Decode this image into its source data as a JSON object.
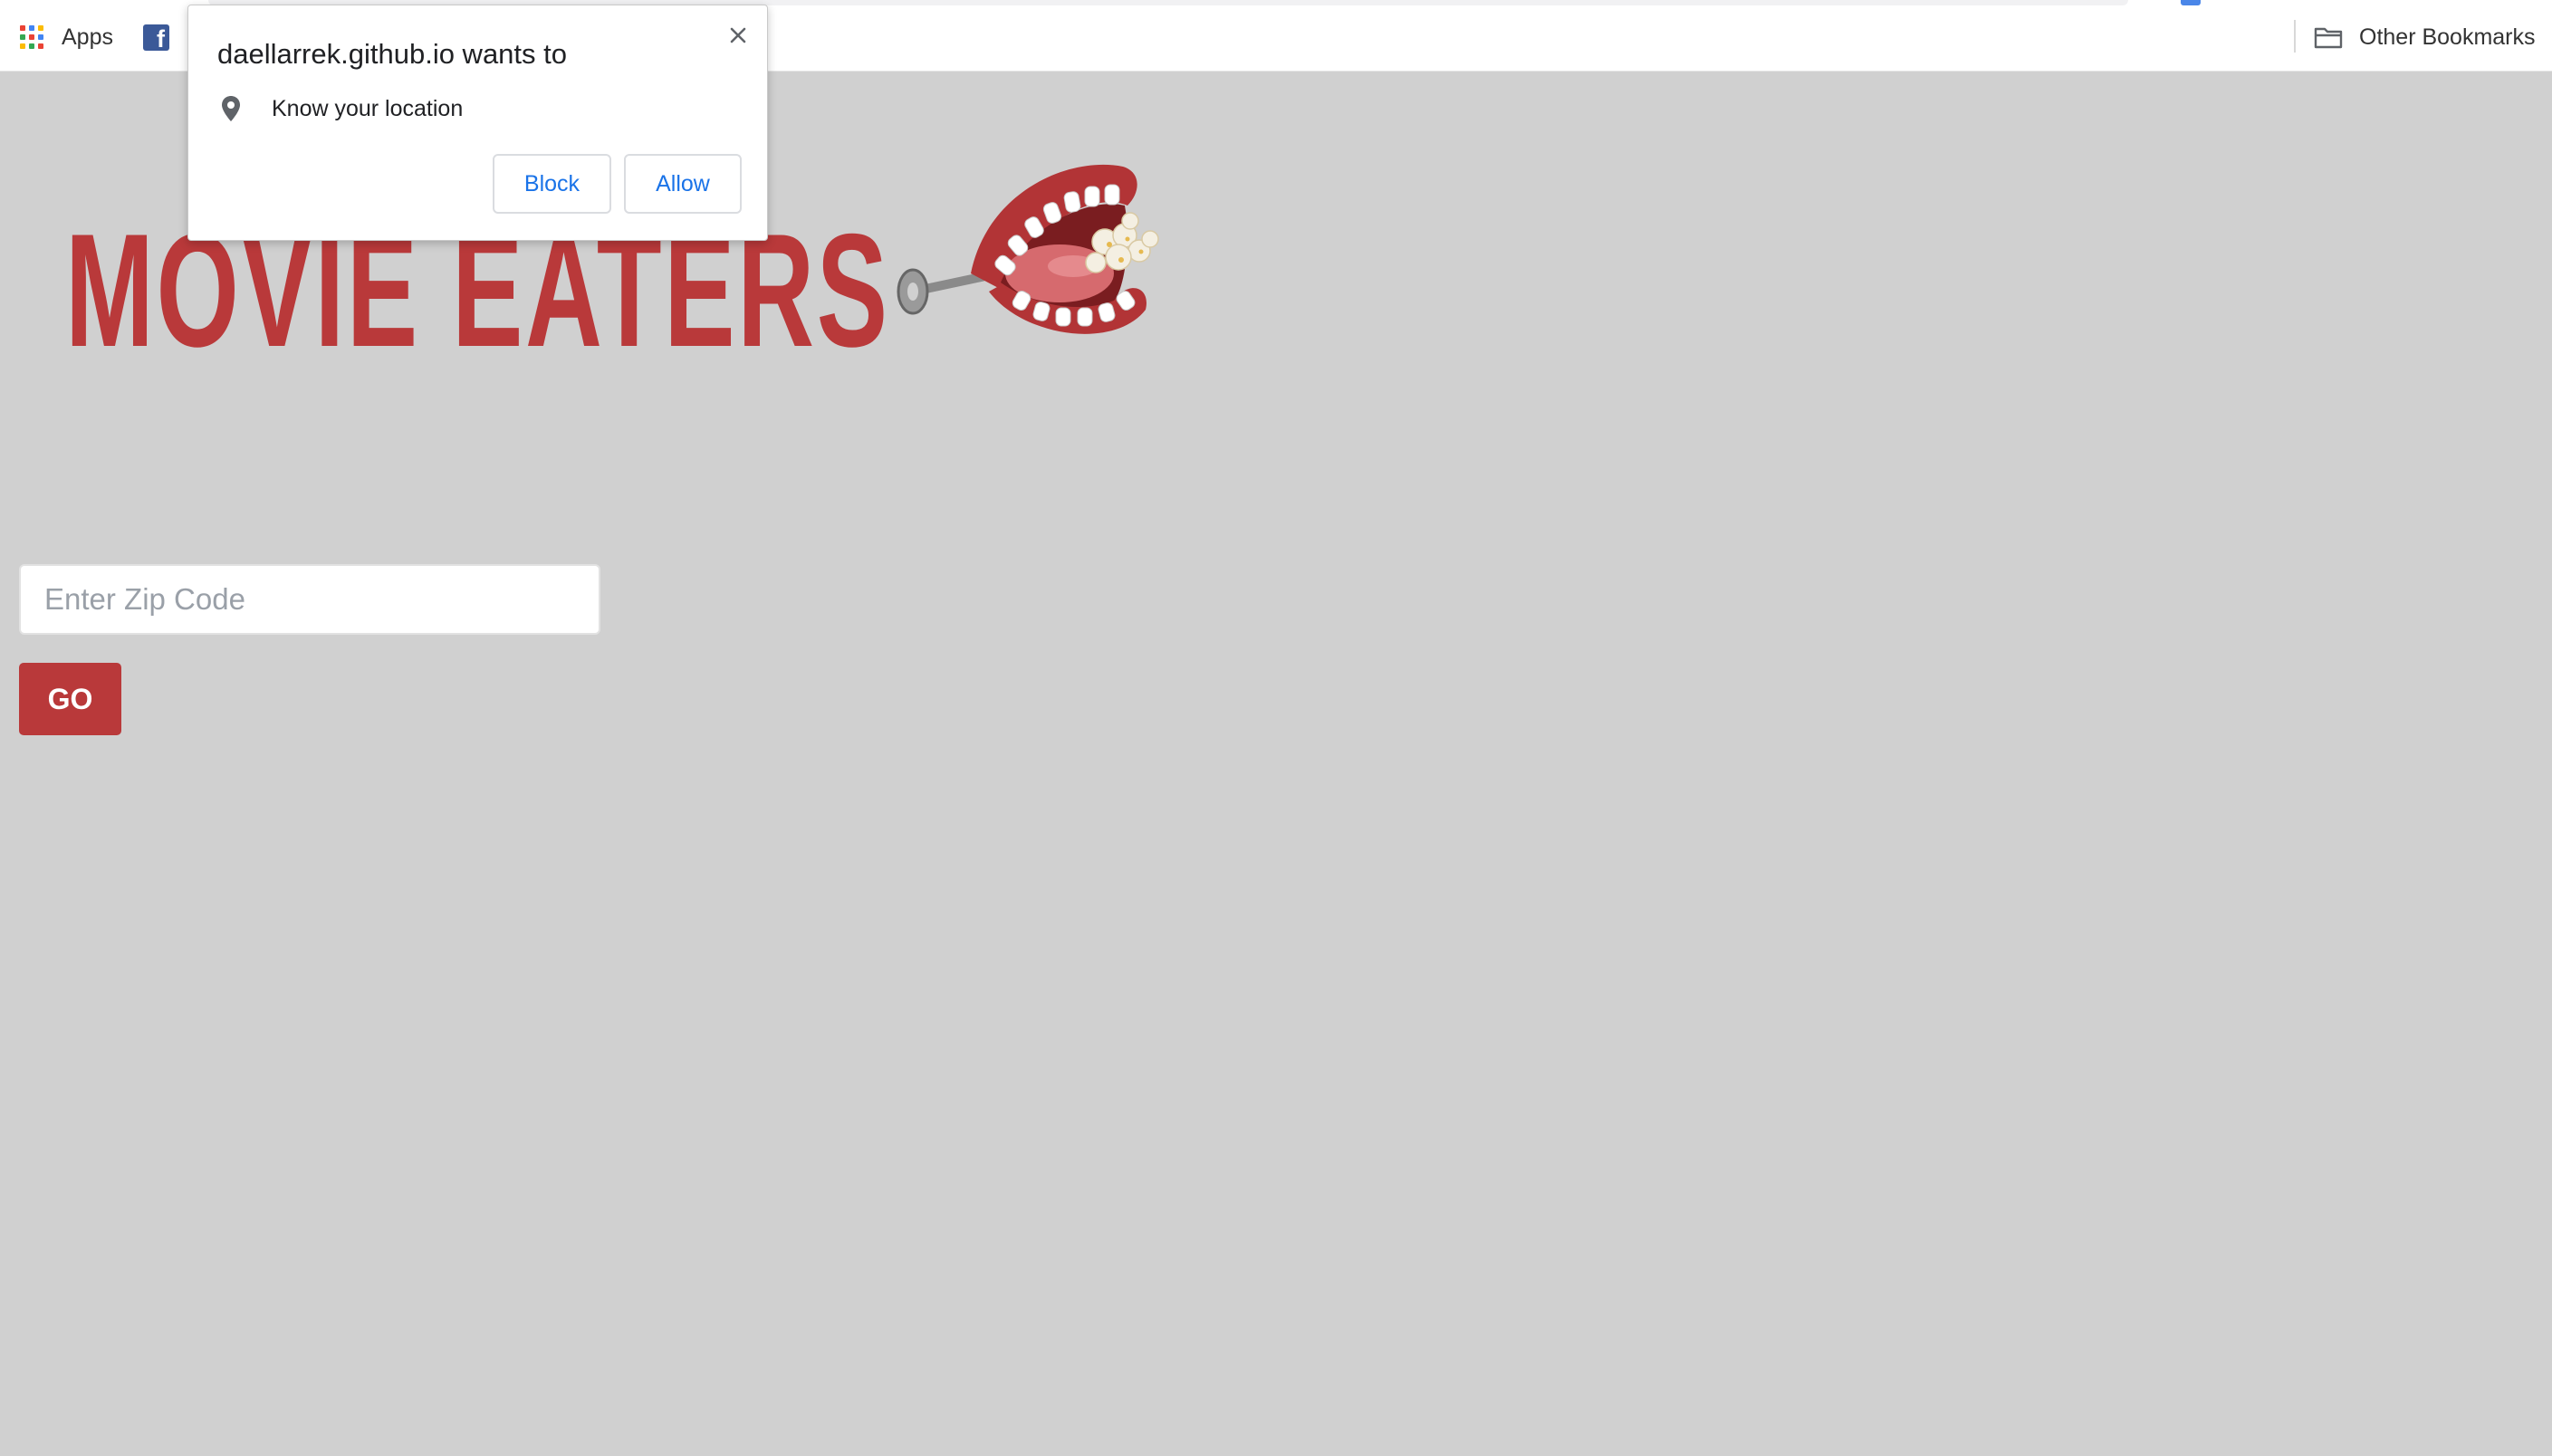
{
  "bookmarks_bar": {
    "apps_label": "Apps",
    "facebook_glyph": "f",
    "other_bookmarks_label": "Other Bookmarks",
    "icons": [
      "apps-grid-icon",
      "facebook-icon",
      "folder-icon"
    ]
  },
  "page": {
    "title": "MOVIE EATERS",
    "mascot_icon": "chattering-teeth-popcorn-icon",
    "zip_placeholder": "Enter Zip Code",
    "zip_value": "",
    "go_label": "GO"
  },
  "permission_popup": {
    "title": "daellarrek.github.io wants to",
    "request_text": "Know your location",
    "request_icon": "location-pin-icon",
    "block_label": "Block",
    "allow_label": "Allow",
    "close_icon": "close-icon"
  },
  "colors": {
    "page_background": "#d0d0d0",
    "brand_red": "#b9393a",
    "link_blue": "#1a73e8",
    "facebook_blue": "#3b5998"
  }
}
